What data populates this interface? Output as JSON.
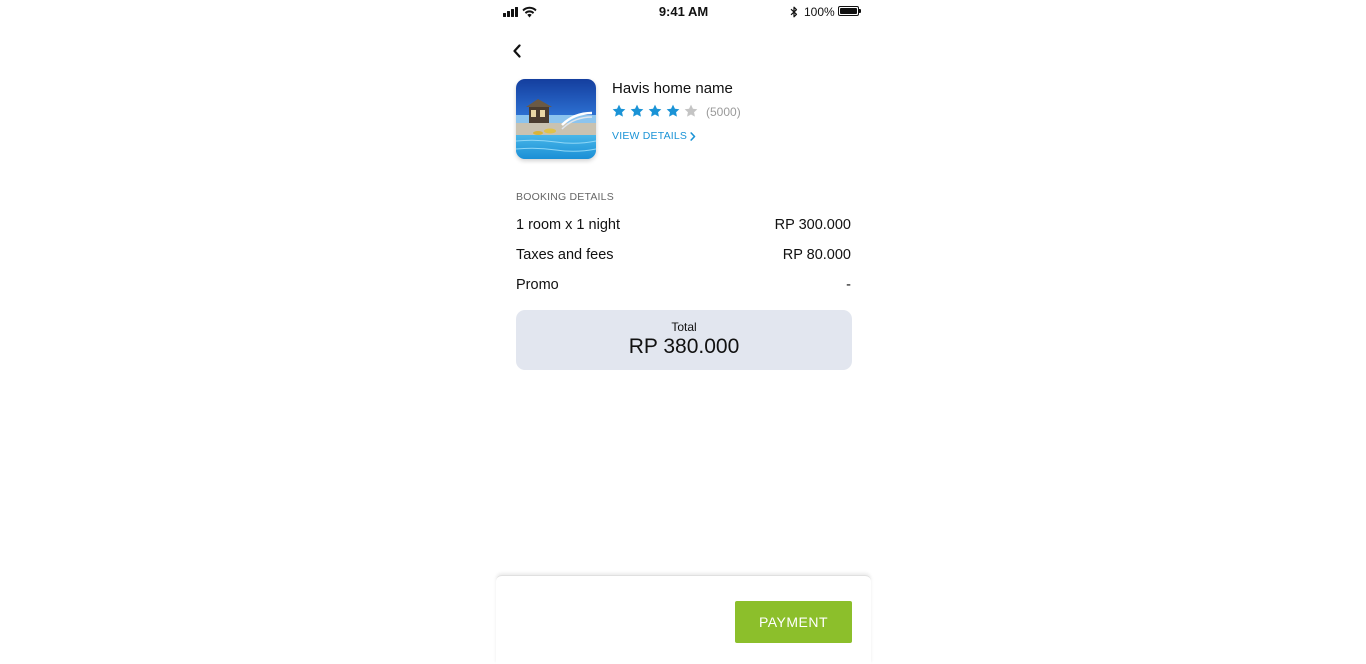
{
  "status_bar": {
    "time": "9:41 AM",
    "battery_percent": "100%"
  },
  "property": {
    "name": "Havis home name",
    "rating": 4,
    "max_rating": 5,
    "review_count": "(5000)",
    "view_details_label": "VIEW DETAILS"
  },
  "booking": {
    "section_label": "BOOKING DETAILS",
    "rows": [
      {
        "label": "1 room x 1 night",
        "value": "RP 300.000"
      },
      {
        "label": "Taxes and fees",
        "value": "RP 80.000"
      },
      {
        "label": "Promo",
        "value": "-"
      }
    ],
    "total_label": "Total",
    "total_value": "RP 380.000"
  },
  "footer": {
    "payment_label": "PAYMENT"
  },
  "icons": {
    "back": "chevron-left-icon",
    "view_details": "chevron-right-icon",
    "star": "star-icon"
  },
  "colors": {
    "star_filled": "#1a93d6",
    "star_empty": "#c4c4c4",
    "link": "#1a93d6",
    "total_bg": "#e2e6ef",
    "payment_button": "#8cbf2b"
  }
}
